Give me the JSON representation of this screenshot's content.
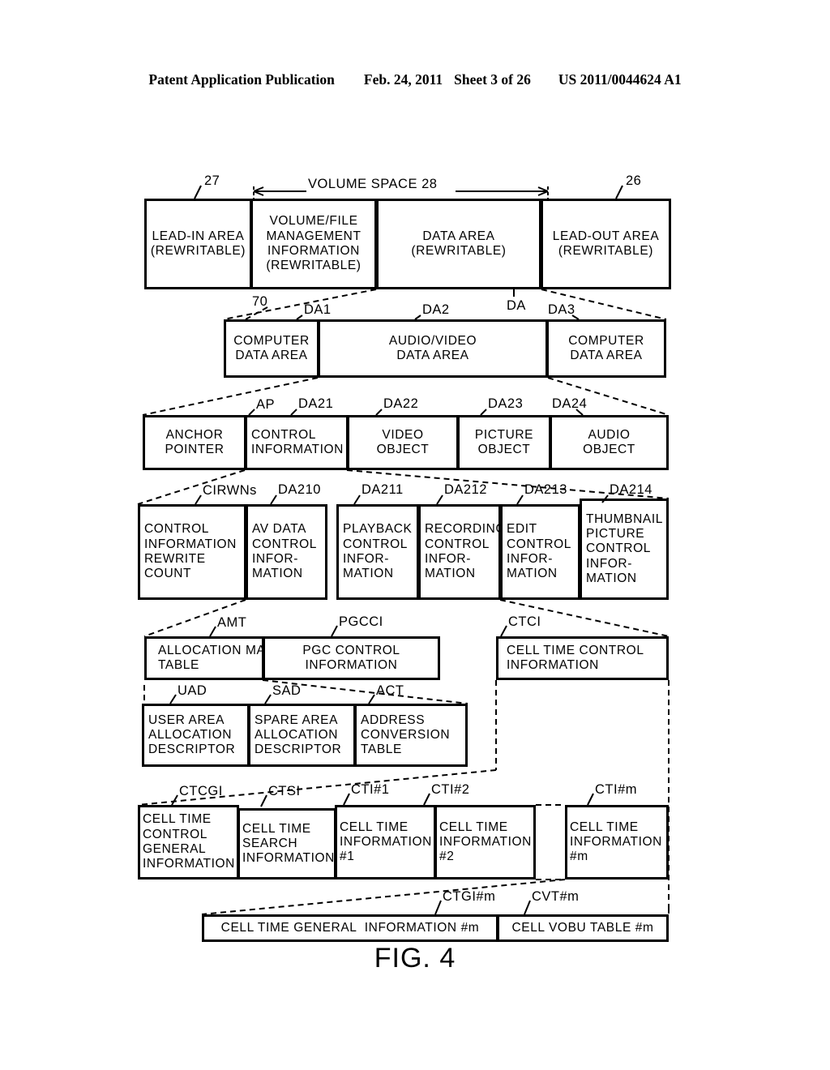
{
  "header": {
    "publication": "Patent Application Publication",
    "date": "Feb. 24, 2011",
    "sheet": "Sheet 3 of 26",
    "patent_number": "US 2011/0044624 A1"
  },
  "figure": {
    "caption": "FIG. 4",
    "volume_space_label": "VOLUME SPACE 28"
  },
  "rows": {
    "row1": {
      "refs": {
        "left": "27",
        "right": "26"
      },
      "boxes": [
        {
          "id": "lead-in-area",
          "lines": [
            "LEAD-IN AREA",
            "(REWRITABLE)"
          ]
        },
        {
          "id": "volume-file-management-information",
          "lines": [
            "VOLUME/FILE",
            "MANAGEMENT",
            "INFORMATION",
            "(REWRITABLE)"
          ]
        },
        {
          "id": "data-area",
          "lines": [
            "DATA AREA",
            "(REWRITABLE)"
          ]
        },
        {
          "id": "lead-out-area",
          "lines": [
            "LEAD-OUT AREA",
            "(REWRITABLE)"
          ]
        }
      ]
    },
    "row2": {
      "refs": {
        "r70": "70",
        "da1": "DA1",
        "da2": "DA2",
        "da": "DA",
        "da3": "DA3"
      },
      "boxes": [
        {
          "id": "computer-data-area-1",
          "lines": [
            "COMPUTER",
            "DATA AREA"
          ]
        },
        {
          "id": "audio-video-data-area",
          "lines": [
            "AUDIO/VIDEO",
            "DATA AREA"
          ]
        },
        {
          "id": "computer-data-area-2",
          "lines": [
            "COMPUTER",
            "DATA AREA"
          ]
        }
      ]
    },
    "row3": {
      "refs": {
        "ap": "AP",
        "da21": "DA21",
        "da22": "DA22",
        "da23": "DA23",
        "da24": "DA24"
      },
      "boxes": [
        {
          "id": "anchor-pointer",
          "lines": [
            "ANCHOR",
            "POINTER"
          ]
        },
        {
          "id": "control-information",
          "lines": [
            "CONTROL",
            "INFORMATION"
          ]
        },
        {
          "id": "video-object",
          "lines": [
            "VIDEO",
            "OBJECT"
          ]
        },
        {
          "id": "picture-object",
          "lines": [
            "PICTURE",
            "OBJECT"
          ]
        },
        {
          "id": "audio-object",
          "lines": [
            "AUDIO",
            "OBJECT"
          ]
        }
      ]
    },
    "row4": {
      "refs": {
        "cirwns": "CIRWNs",
        "da210": "DA210",
        "da211": "DA211",
        "da212": "DA212",
        "da213": "DA213",
        "da214": "DA214"
      },
      "boxes": [
        {
          "id": "control-information-rewrite-count",
          "lines": [
            "CONTROL",
            "INFORMATION",
            "REWRITE",
            "COUNT"
          ]
        },
        {
          "id": "av-data-control-information",
          "lines": [
            "AV DATA",
            "CONTROL",
            "INFOR-",
            "MATION"
          ]
        },
        {
          "id": "playback-control-information",
          "lines": [
            "PLAYBACK",
            "CONTROL",
            "INFOR-",
            "MATION"
          ]
        },
        {
          "id": "recording-control-information",
          "lines": [
            "RECORDING",
            "CONTROL",
            "INFOR-",
            "MATION"
          ]
        },
        {
          "id": "edit-control-information",
          "lines": [
            "EDIT",
            "CONTROL",
            "INFOR-",
            "MATION"
          ]
        },
        {
          "id": "thumbnail-picture-control-information",
          "lines": [
            "THUMBNAIL",
            "PICTURE",
            "CONTROL",
            "INFOR-",
            "MATION"
          ]
        }
      ]
    },
    "row5": {
      "refs": {
        "amt": "AMT",
        "pgcci": "PGCCI",
        "ctci": "CTCI"
      },
      "boxes": [
        {
          "id": "allocation-map-table",
          "lines": [
            "ALLOCATION MAP",
            "TABLE"
          ]
        },
        {
          "id": "pgc-control-information",
          "lines": [
            "PGC CONTROL",
            "INFORMATION"
          ]
        },
        {
          "id": "cell-time-control-information",
          "lines": [
            "CELL TIME CONTROL",
            "INFORMATION"
          ]
        }
      ]
    },
    "row6": {
      "refs": {
        "uad": "UAD",
        "sad": "SAD",
        "act": "ACT"
      },
      "boxes": [
        {
          "id": "user-area-allocation-descriptor",
          "lines": [
            "USER AREA",
            "ALLOCATION",
            "DESCRIPTOR"
          ]
        },
        {
          "id": "spare-area-allocation-descriptor",
          "lines": [
            "SPARE AREA",
            "ALLOCATION",
            "DESCRIPTOR"
          ]
        },
        {
          "id": "address-conversion-table",
          "lines": [
            "ADDRESS",
            "CONVERSION",
            "TABLE"
          ]
        }
      ]
    },
    "row7": {
      "refs": {
        "ctcgi": "CTCGI",
        "ctsi": "CTSI",
        "cti1": "CTI#1",
        "cti2": "CTI#2",
        "ctim": "CTI#m"
      },
      "boxes": [
        {
          "id": "cell-time-control-general-information",
          "lines": [
            "CELL TIME",
            "CONTROL",
            "GENERAL",
            "INFORMATION"
          ]
        },
        {
          "id": "cell-time-search-information",
          "lines": [
            "CELL TIME",
            "SEARCH",
            "INFORMATION"
          ]
        },
        {
          "id": "cell-time-information-1",
          "lines": [
            "CELL TIME",
            "INFORMATION",
            "#1"
          ]
        },
        {
          "id": "cell-time-information-2",
          "lines": [
            "CELL TIME",
            "INFORMATION",
            "#2"
          ]
        },
        {
          "id": "cell-time-information-m",
          "lines": [
            "CELL TIME",
            "INFORMATION",
            "#m"
          ]
        }
      ]
    },
    "row8": {
      "refs": {
        "ctgim": "CTGI#m",
        "cvtm": "CVT#m"
      },
      "boxes": [
        {
          "id": "cell-time-general-information-m",
          "lines": [
            "CELL TIME GENERAL  INFORMATION #m"
          ]
        },
        {
          "id": "cell-vobu-table-m",
          "lines": [
            "CELL VOBU TABLE #m"
          ]
        }
      ]
    }
  }
}
